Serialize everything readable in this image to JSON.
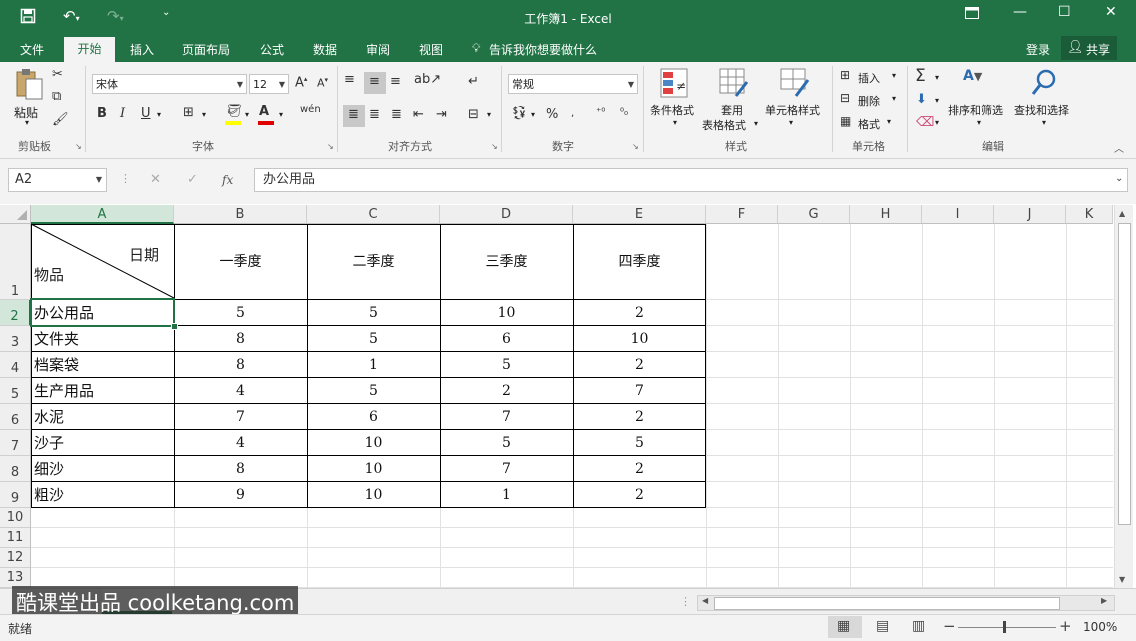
{
  "window": {
    "title": "工作簿1 - Excel"
  },
  "menu": {
    "tabs": [
      "文件",
      "开始",
      "插入",
      "页面布局",
      "公式",
      "数据",
      "审阅",
      "视图"
    ],
    "tell_me": "告诉我你想要做什么",
    "login": "登录",
    "share": "共享"
  },
  "ribbon": {
    "clipboard": {
      "paste": "粘贴",
      "label": "剪贴板"
    },
    "font": {
      "name": "宋体",
      "size": "12",
      "label": "字体"
    },
    "alignment": {
      "label": "对齐方式"
    },
    "number": {
      "format": "常规",
      "label": "数字"
    },
    "styles": {
      "conditional": "条件格式",
      "table_top": "套用",
      "table_bottom": "表格格式",
      "cell_styles": "单元格样式",
      "label": "样式"
    },
    "cells": {
      "insert": "插入",
      "delete": "删除",
      "format": "格式",
      "label": "单元格"
    },
    "editing": {
      "sort": "排序和筛选",
      "find": "查找和选择",
      "label": "编辑"
    }
  },
  "formula_bar": {
    "name_box": "A2",
    "content": "办公用品",
    "fx": "fx"
  },
  "sheet": {
    "columns": [
      "A",
      "B",
      "C",
      "D",
      "E",
      "F",
      "G",
      "H",
      "I",
      "J",
      "K"
    ],
    "rows": [
      "1",
      "2",
      "3",
      "4",
      "5",
      "6",
      "7",
      "8",
      "9",
      "10",
      "11",
      "12",
      "13"
    ],
    "header_cell": {
      "top": "日期",
      "bottom": "物品"
    },
    "quarters": [
      "一季度",
      "二季度",
      "三季度",
      "四季度"
    ],
    "data": [
      {
        "item": "办公用品",
        "values": [
          "5",
          "5",
          "10",
          "2"
        ]
      },
      {
        "item": "文件夹",
        "values": [
          "8",
          "5",
          "6",
          "10"
        ]
      },
      {
        "item": "档案袋",
        "values": [
          "8",
          "1",
          "5",
          "2"
        ]
      },
      {
        "item": "生产用品",
        "values": [
          "4",
          "5",
          "2",
          "7"
        ]
      },
      {
        "item": "水泥",
        "values": [
          "7",
          "6",
          "7",
          "2"
        ]
      },
      {
        "item": "沙子",
        "values": [
          "4",
          "10",
          "5",
          "5"
        ]
      },
      {
        "item": "细沙",
        "values": [
          "8",
          "10",
          "7",
          "2"
        ]
      },
      {
        "item": "粗沙",
        "values": [
          "9",
          "10",
          "1",
          "2"
        ]
      }
    ]
  },
  "status": {
    "ready": "就绪",
    "zoom": "100%"
  },
  "watermark": "酷课堂出品 coolketang.com",
  "colors": {
    "excel_green": "#217346",
    "ribbon_bg": "#f3f3f3"
  }
}
